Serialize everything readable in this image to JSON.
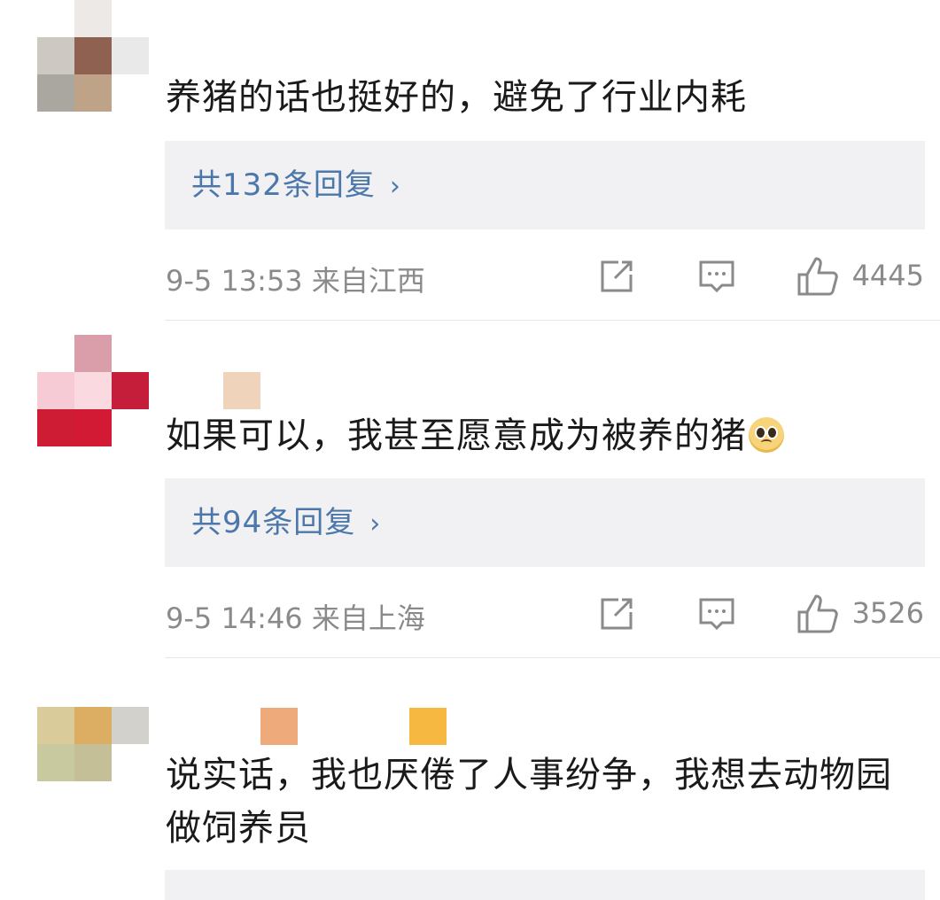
{
  "comments": [
    {
      "text": "养猪的话也挺好的，避免了行业内耗",
      "reply_label": "共132条回复",
      "time": "9-5 13:53 来自江西",
      "likes": "4445"
    },
    {
      "text": "如果可以，我甚至愿意成为被养的猪",
      "emoji": "pleading-face-emoji",
      "reply_label": "共94条回复",
      "time": "9-5 14:46 来自上海",
      "likes": "3526"
    },
    {
      "text": "说实话，我也厌倦了人事纷争，我想去动物园做饲养员"
    }
  ],
  "icons": {
    "share": "share-icon",
    "comment": "comment-icon",
    "like": "thumbs-up-icon",
    "chevron": "chevron-right-icon"
  },
  "colors": {
    "link": "#4b77ab",
    "meta": "#8a8a8a",
    "reply_bg": "#f1f1f3"
  }
}
